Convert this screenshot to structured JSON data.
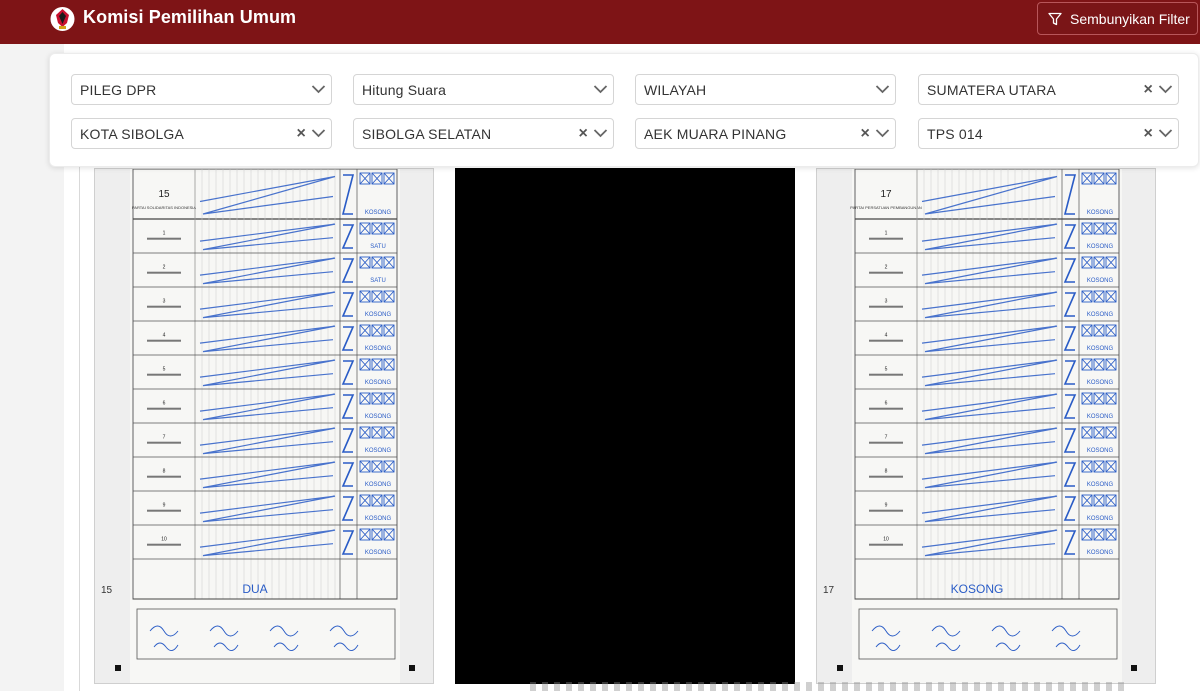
{
  "header": {
    "brand": "Komisi Pemilihan Umum",
    "filter_button_label": "Sembunyikan Filter",
    "accent_color": "#7e1416"
  },
  "filters": {
    "row1": [
      {
        "value": "PILEG DPR",
        "clearable": false
      },
      {
        "value": "Hitung Suara",
        "clearable": false
      },
      {
        "value": "WILAYAH",
        "clearable": false
      },
      {
        "value": "SUMATERA UTARA",
        "clearable": true
      }
    ],
    "row2": [
      {
        "value": "KOTA SIBOLGA",
        "clearable": true
      },
      {
        "value": "SIBOLGA SELATAN",
        "clearable": true
      },
      {
        "value": "AEK MUARA PINANG",
        "clearable": true
      },
      {
        "value": "TPS 014",
        "clearable": true
      }
    ]
  },
  "documents": {
    "left": {
      "party_number": "15",
      "party_name": "PARTAI SOLIDARITAS INDONESIA",
      "side_number": "15",
      "candidate_numbers": [
        "1",
        "2",
        "3",
        "4",
        "5",
        "6",
        "7",
        "8",
        "9",
        "10"
      ],
      "written_total": "DUA",
      "row_words": [
        "KOSONG",
        "SATU",
        "SATU",
        "KOSONG",
        "KOSONG",
        "KOSONG",
        "KOSONG",
        "KOSONG",
        "KOSONG",
        "KOSONG",
        "KOSONG"
      ]
    },
    "middle": {
      "description": "dark-image-panel"
    },
    "right": {
      "party_number": "17",
      "party_name": "PARTAI PERSATUAN PEMBANGUNAN",
      "side_number": "17",
      "candidate_numbers": [
        "1",
        "2",
        "3",
        "4",
        "5",
        "6",
        "7",
        "8",
        "9",
        "10"
      ],
      "written_total": "KOSONG",
      "row_words": [
        "KOSONG",
        "KOSONG",
        "KOSONG",
        "KOSONG",
        "KOSONG",
        "KOSONG",
        "KOSONG",
        "KOSONG",
        "KOSONG",
        "KOSONG",
        "KOSONG"
      ]
    }
  }
}
